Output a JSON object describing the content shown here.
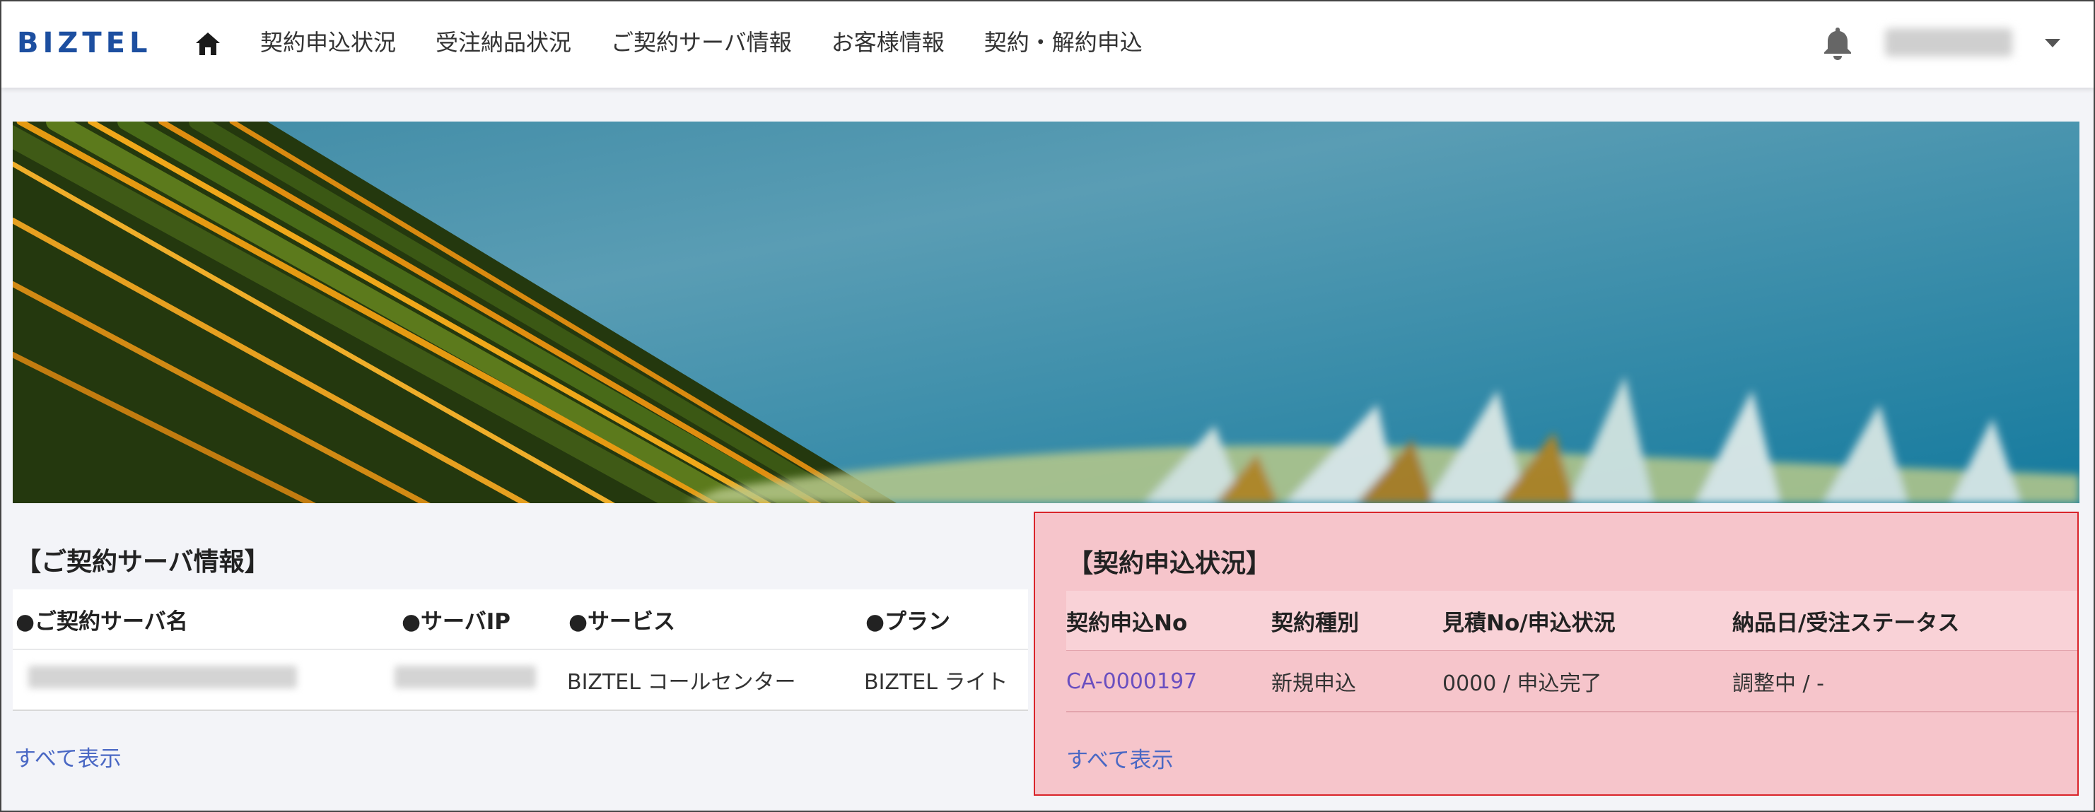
{
  "header": {
    "logo_text": "BIZTEL",
    "nav": [
      {
        "label": "契約申込状況"
      },
      {
        "label": "受注納品状況"
      },
      {
        "label": "ご契約サーバ情報"
      },
      {
        "label": "お客様情報"
      },
      {
        "label": "契約・解約申込"
      }
    ],
    "icons": {
      "home": "home-icon",
      "notifications": "bell-icon",
      "account_menu": "chevron-down-icon"
    },
    "colors": {
      "logo": "#1d4fa0"
    }
  },
  "server_info": {
    "title": "【ご契約サーバ情報】",
    "columns": [
      "●ご契約サーバ名",
      "●サーバIP",
      "●サービス",
      "●プラン"
    ],
    "rows": [
      {
        "service": "BIZTEL コールセンター",
        "plan": "BIZTEL ライト"
      }
    ],
    "show_all": "すべて表示"
  },
  "contract_status": {
    "title": "【契約申込状況】",
    "columns": [
      "契約申込No",
      "契約種別",
      "見積No/申込状況",
      "納品日/受注ステータス"
    ],
    "rows": [
      {
        "no": "CA-0000197",
        "type": "新規申込",
        "estimate_status": "0000 / 申込完了",
        "delivery_status": "調整中 / -"
      }
    ],
    "show_all": "すべて表示",
    "colors": {
      "highlight_bg": "#f6c5cb",
      "highlight_border": "#d9242a"
    }
  }
}
